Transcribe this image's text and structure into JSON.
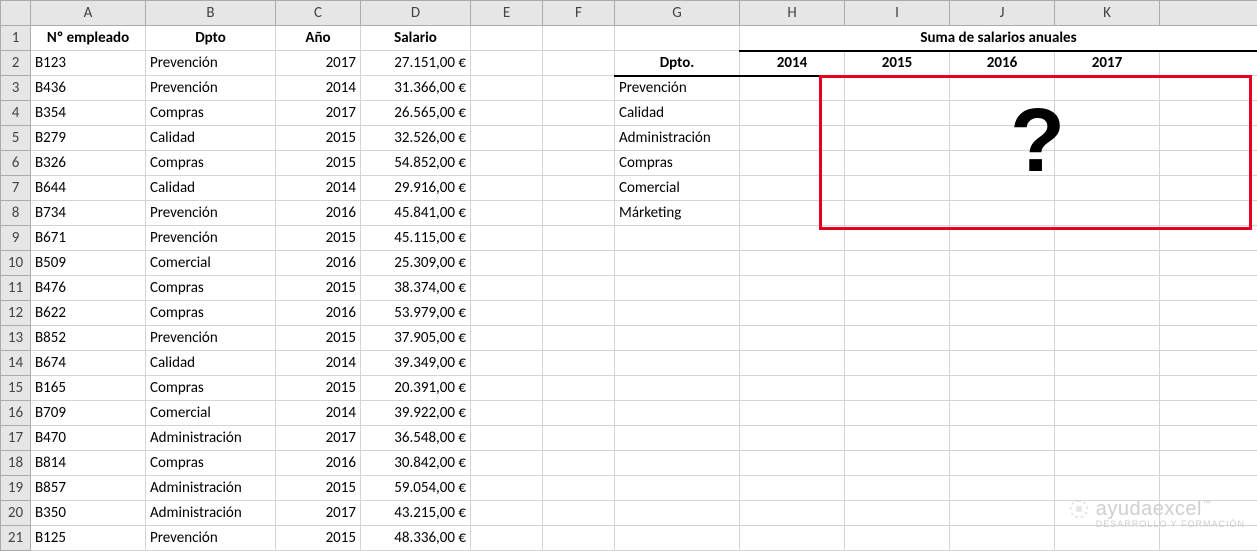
{
  "columns": [
    "A",
    "B",
    "C",
    "D",
    "E",
    "F",
    "G",
    "H",
    "I",
    "J",
    "K",
    ""
  ],
  "headers": {
    "A": "Nº empleado",
    "B": "Dpto",
    "C": "Año",
    "D": "Salario"
  },
  "rows": [
    {
      "A": "B123",
      "B": "Prevención",
      "C": "2017",
      "D": "27.151,00 €"
    },
    {
      "A": "B436",
      "B": "Prevención",
      "C": "2014",
      "D": "31.366,00 €"
    },
    {
      "A": "B354",
      "B": "Compras",
      "C": "2017",
      "D": "26.565,00 €"
    },
    {
      "A": "B279",
      "B": "Calidad",
      "C": "2015",
      "D": "32.526,00 €"
    },
    {
      "A": "B326",
      "B": "Compras",
      "C": "2015",
      "D": "54.852,00 €"
    },
    {
      "A": "B644",
      "B": "Calidad",
      "C": "2014",
      "D": "29.916,00 €"
    },
    {
      "A": "B734",
      "B": "Prevención",
      "C": "2016",
      "D": "45.841,00 €"
    },
    {
      "A": "B671",
      "B": "Prevención",
      "C": "2015",
      "D": "45.115,00 €"
    },
    {
      "A": "B509",
      "B": "Comercial",
      "C": "2016",
      "D": "25.309,00 €"
    },
    {
      "A": "B476",
      "B": "Compras",
      "C": "2015",
      "D": "38.374,00 €"
    },
    {
      "A": "B622",
      "B": "Compras",
      "C": "2016",
      "D": "53.979,00 €"
    },
    {
      "A": "B852",
      "B": "Prevención",
      "C": "2015",
      "D": "37.905,00 €"
    },
    {
      "A": "B674",
      "B": "Calidad",
      "C": "2014",
      "D": "39.349,00 €"
    },
    {
      "A": "B165",
      "B": "Compras",
      "C": "2015",
      "D": "20.391,00 €"
    },
    {
      "A": "B709",
      "B": "Comercial",
      "C": "2014",
      "D": "39.922,00 €"
    },
    {
      "A": "B470",
      "B": "Administración",
      "C": "2017",
      "D": "36.548,00 €"
    },
    {
      "A": "B814",
      "B": "Compras",
      "C": "2016",
      "D": "30.842,00 €"
    },
    {
      "A": "B857",
      "B": "Administración",
      "C": "2015",
      "D": "59.054,00 €"
    },
    {
      "A": "B350",
      "B": "Administración",
      "C": "2017",
      "D": "43.215,00 €"
    },
    {
      "A": "B125",
      "B": "Prevención",
      "C": "2015",
      "D": "48.336,00 €"
    }
  ],
  "summary": {
    "title": "Suma de salarios anuales",
    "dpto_label": "Dpto.",
    "years": [
      "2014",
      "2015",
      "2016",
      "2017"
    ],
    "departments": [
      "Prevención",
      "Calidad",
      "Administración",
      "Compras",
      "Comercial",
      "Márketing"
    ]
  },
  "overlay": {
    "question": "?"
  },
  "watermark": {
    "brand": "ayudaexcel",
    "tag": "DESARROLLO Y FORMACIÓN",
    "tm": "™"
  }
}
